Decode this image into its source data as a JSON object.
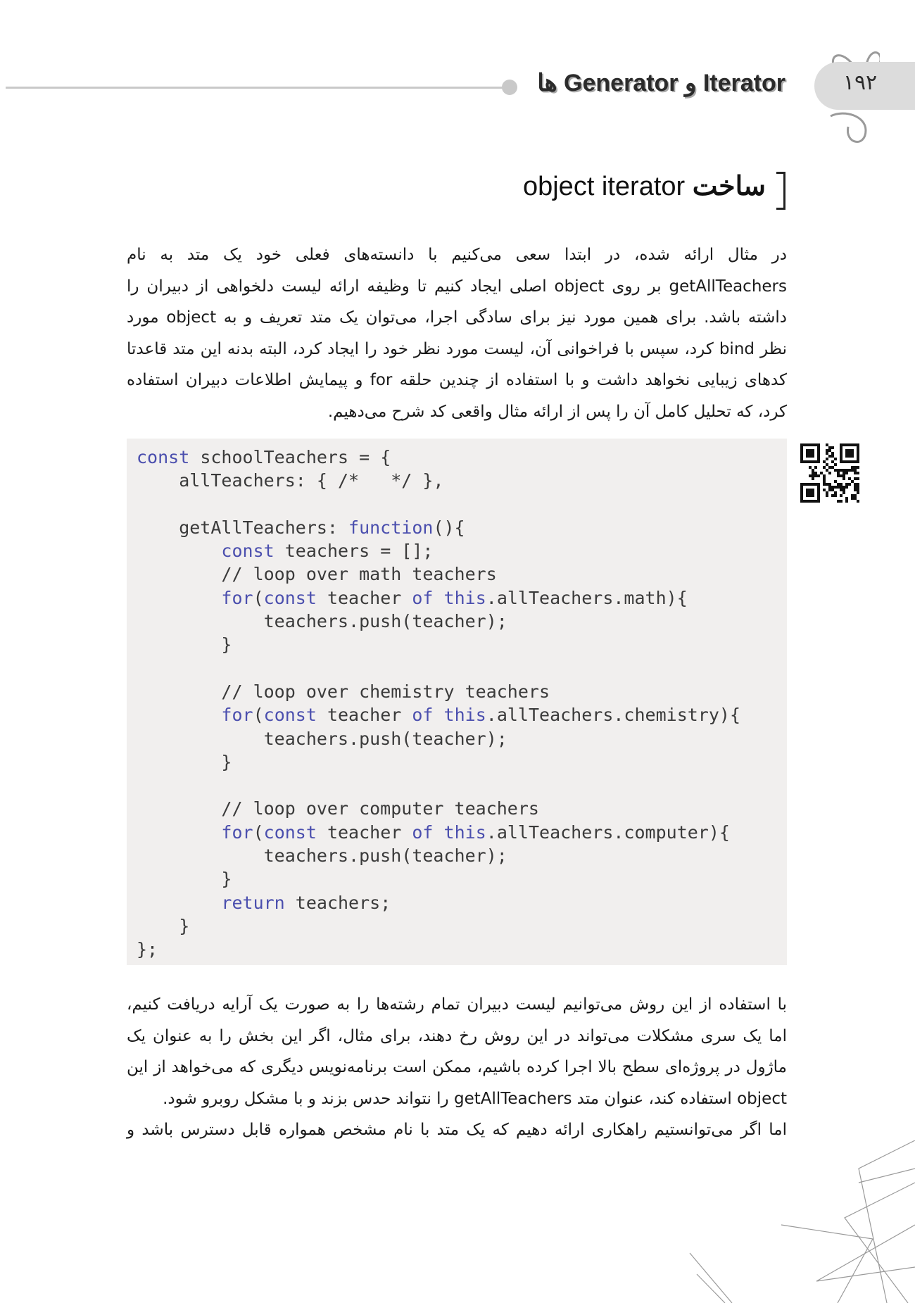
{
  "header": {
    "page_number": "۱۹۲",
    "chapter_title": "Iterator و Generator ها"
  },
  "section": {
    "heading_fa": "ساخت",
    "heading_en": "object iterator"
  },
  "paragraph1": {
    "lines": [
      "در مثال ارائه شده، در ابتدا سعی می‌کنیم با دانسته‌های فعلی خود یک متد به نام",
      "getAllTeachers بر روی object اصلی ایجاد کنیم تا وظیفه ارائه لیست دلخواهی از دبیران را",
      "داشته باشد. برای همین مورد نیز برای سادگی اجرا، می‌توان یک متد تعریف و به object مورد",
      "نظر bind کرد، سپس با فراخوانی آن، لیست مورد نظر خود را ایجاد کرد، البته بدنه این متد قاعدتا",
      "کدهای زیبایی نخواهد داشت و با استفاده از چندین حلقه for و پیمایش اطلاعات دبیران استفاده",
      "کرد، که  تحلیل کامل آن را پس از ارائه مثال واقعی کد شرح می‌دهیم."
    ]
  },
  "code": {
    "lines": [
      [
        {
          "t": "const",
          "k": true
        },
        {
          "t": " schoolTeachers = {"
        }
      ],
      [
        {
          "t": "    allTeachers: { /*   */ },"
        }
      ],
      [
        {
          "t": ""
        }
      ],
      [
        {
          "t": "    getAllTeachers: "
        },
        {
          "t": "function",
          "k": true
        },
        {
          "t": "(){"
        }
      ],
      [
        {
          "t": "        "
        },
        {
          "t": "const",
          "k": true
        },
        {
          "t": " teachers = [];"
        }
      ],
      [
        {
          "t": "        // loop over math teachers"
        }
      ],
      [
        {
          "t": "        "
        },
        {
          "t": "for",
          "k": true
        },
        {
          "t": "("
        },
        {
          "t": "const",
          "k": true
        },
        {
          "t": " teacher "
        },
        {
          "t": "of",
          "k": true
        },
        {
          "t": " "
        },
        {
          "t": "this",
          "k": true
        },
        {
          "t": ".allTeachers.math){"
        }
      ],
      [
        {
          "t": "            teachers.push(teacher);"
        }
      ],
      [
        {
          "t": "        }"
        }
      ],
      [
        {
          "t": ""
        }
      ],
      [
        {
          "t": "        // loop over chemistry teachers"
        }
      ],
      [
        {
          "t": "        "
        },
        {
          "t": "for",
          "k": true
        },
        {
          "t": "("
        },
        {
          "t": "const",
          "k": true
        },
        {
          "t": " teacher "
        },
        {
          "t": "of",
          "k": true
        },
        {
          "t": " "
        },
        {
          "t": "this",
          "k": true
        },
        {
          "t": ".allTeachers.chemistry){"
        }
      ],
      [
        {
          "t": "            teachers.push(teacher);"
        }
      ],
      [
        {
          "t": "        }"
        }
      ],
      [
        {
          "t": ""
        }
      ],
      [
        {
          "t": "        // loop over computer teachers"
        }
      ],
      [
        {
          "t": "        "
        },
        {
          "t": "for",
          "k": true
        },
        {
          "t": "("
        },
        {
          "t": "const",
          "k": true
        },
        {
          "t": " teacher "
        },
        {
          "t": "of",
          "k": true
        },
        {
          "t": " "
        },
        {
          "t": "this",
          "k": true
        },
        {
          "t": ".allTeachers.computer){"
        }
      ],
      [
        {
          "t": "            teachers.push(teacher);"
        }
      ],
      [
        {
          "t": "        }"
        }
      ],
      [
        {
          "t": "        "
        },
        {
          "t": "return",
          "k": true
        },
        {
          "t": " teachers;"
        }
      ],
      [
        {
          "t": "    }"
        }
      ],
      [
        {
          "t": "};"
        }
      ]
    ]
  },
  "paragraph2": {
    "lines": [
      "با استفاده از این روش می‌توانیم لیست دبیران تمام رشته‌ها را به صورت یک آرایه دریافت کنیم،",
      "اما یک سری مشکلات می‌تواند در این روش رخ دهند، برای مثال، اگر این بخش را به عنوان یک",
      "ماژول در پروژه‌ای سطح بالا اجرا کرده باشیم، ممکن است برنامه‌نویس دیگری که می‌خواهد از این",
      "object استفاده کند، عنوان متد getAllTeachers را نتواند حدس بزند و با مشکل روبرو شود.",
      "اما اگر می‌توانستیم راهکاری ارائه دهیم که یک متد با نام مشخص همواره قابل دسترس باشد و"
    ]
  }
}
